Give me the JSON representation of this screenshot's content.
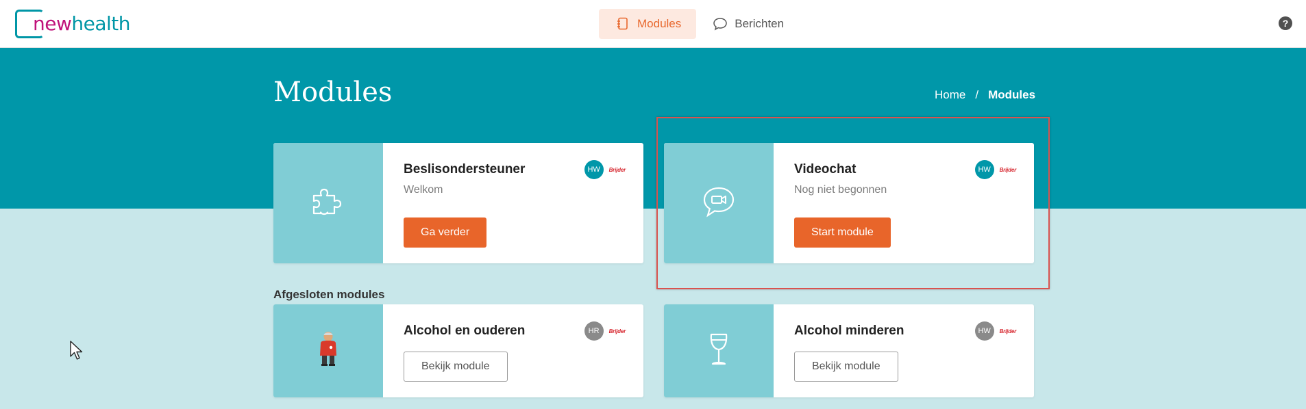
{
  "header": {
    "logo_new": "new",
    "logo_health": "health",
    "nav": [
      {
        "label": "Modules",
        "icon": "notebook-icon",
        "active": true
      },
      {
        "label": "Berichten",
        "icon": "speech-bubble-icon",
        "active": false
      }
    ],
    "help_label": "?"
  },
  "page": {
    "title": "Modules",
    "breadcrumb": {
      "home": "Home",
      "separator": "/",
      "current": "Modules"
    }
  },
  "active_modules": [
    {
      "title": "Beslisondersteuner",
      "subtitle": "Welkom",
      "avatar": "HW",
      "brand": "Brijder",
      "button": "Ga verder",
      "icon": "puzzle-icon"
    },
    {
      "title": "Videochat",
      "subtitle": "Nog niet begonnen",
      "avatar": "HW",
      "brand": "Brijder",
      "button": "Start module",
      "icon": "video-chat-icon"
    }
  ],
  "closed_section_title": "Afgesloten modules",
  "closed_modules": [
    {
      "title": "Alcohol en ouderen",
      "avatar": "HR",
      "brand": "Brijder",
      "button": "Bekijk module",
      "icon": "elderly-man-illustration"
    },
    {
      "title": "Alcohol minderen",
      "avatar": "HW",
      "brand": "Brijder",
      "button": "Bekijk module",
      "icon": "wine-glass-icon"
    }
  ],
  "colors": {
    "brand_teal": "#0097a9",
    "brand_orange": "#e8652a",
    "media_teal": "#80cdd5",
    "page_bg": "#c8e7ea",
    "highlight": "#d9534f"
  }
}
